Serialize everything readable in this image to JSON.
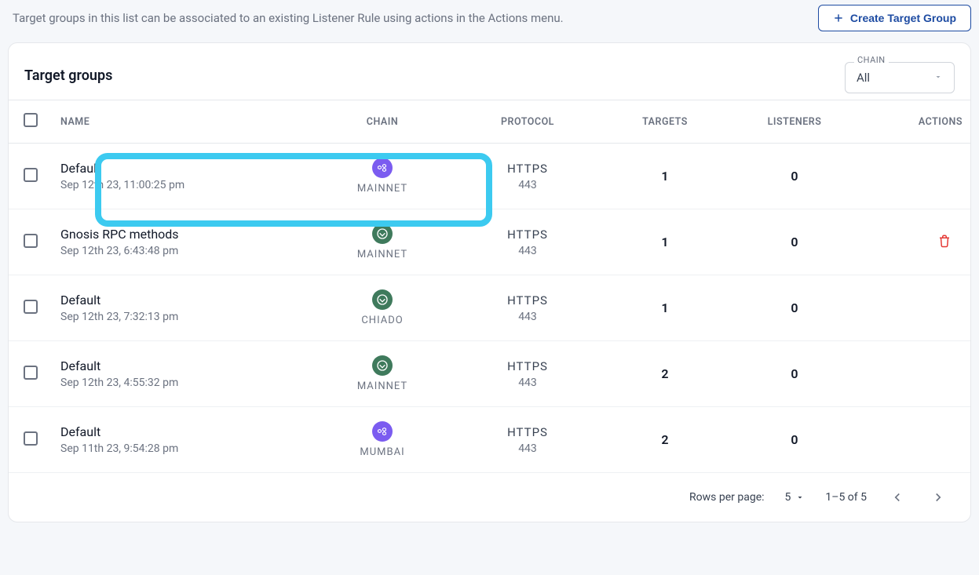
{
  "hint": "Target groups in this list can be associated to an existing Listener Rule using actions in the Actions menu.",
  "create_button": "Create Target Group",
  "card_title": "Target groups",
  "chain_filter": {
    "legend": "CHAIN",
    "value": "All"
  },
  "columns": {
    "name": "NAME",
    "chain": "CHAIN",
    "protocol": "PROTOCOL",
    "targets": "TARGETS",
    "listeners": "LISTENERS",
    "actions": "ACTIONS"
  },
  "rows": [
    {
      "name": "Default",
      "date": "Sep 12th 23, 11:00:25 pm",
      "chain_icon": "polygon",
      "chain": "MAINNET",
      "protocol": "HTTPS",
      "port": "443",
      "targets": "1",
      "listeners": "0",
      "deletable": false,
      "highlighted": true
    },
    {
      "name": "Gnosis RPC methods",
      "date": "Sep 12th 23, 6:43:48 pm",
      "chain_icon": "gnosis",
      "chain": "MAINNET",
      "protocol": "HTTPS",
      "port": "443",
      "targets": "1",
      "listeners": "0",
      "deletable": true,
      "highlighted": false
    },
    {
      "name": "Default",
      "date": "Sep 12th 23, 7:32:13 pm",
      "chain_icon": "gnosis",
      "chain": "CHIADO",
      "protocol": "HTTPS",
      "port": "443",
      "targets": "1",
      "listeners": "0",
      "deletable": false,
      "highlighted": false
    },
    {
      "name": "Default",
      "date": "Sep 12th 23, 4:55:32 pm",
      "chain_icon": "gnosis",
      "chain": "MAINNET",
      "protocol": "HTTPS",
      "port": "443",
      "targets": "2",
      "listeners": "0",
      "deletable": false,
      "highlighted": false
    },
    {
      "name": "Default",
      "date": "Sep 11th 23, 9:54:28 pm",
      "chain_icon": "polygon",
      "chain": "MUMBAI",
      "protocol": "HTTPS",
      "port": "443",
      "targets": "2",
      "listeners": "0",
      "deletable": false,
      "highlighted": false
    }
  ],
  "pagination": {
    "rows_label": "Rows per page:",
    "rows_value": "5",
    "range": "1–5 of 5"
  }
}
